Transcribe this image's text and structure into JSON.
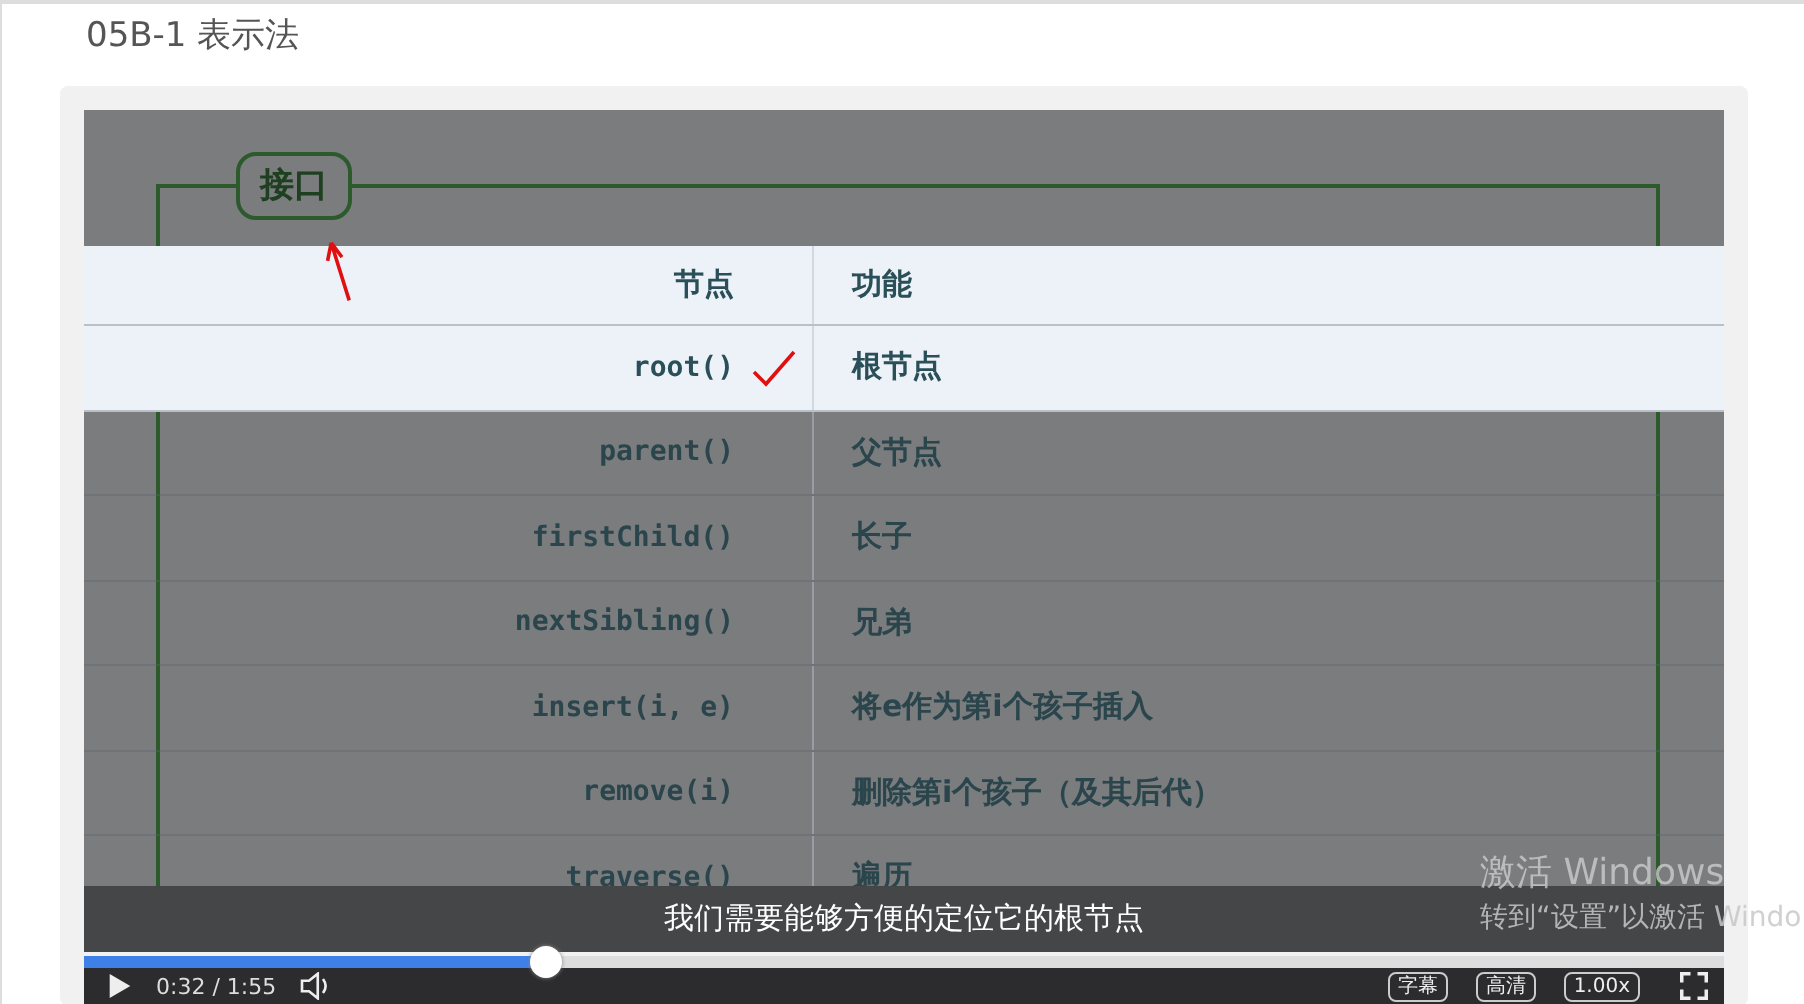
{
  "page_title": "05B-1 表示法",
  "video": {
    "slide": {
      "badge": "接口",
      "header_highlighted": true,
      "columns": [
        "节点",
        "功能"
      ],
      "rows": [
        {
          "cells": [
            "root()",
            "根节点"
          ],
          "highlighted": true,
          "ticked": true
        },
        {
          "cells": [
            "parent()",
            "父节点"
          ],
          "highlighted": false,
          "ticked": false
        },
        {
          "cells": [
            "firstChild()",
            "长子"
          ],
          "highlighted": false,
          "ticked": false
        },
        {
          "cells": [
            "nextSibling()",
            "兄弟"
          ],
          "highlighted": false,
          "ticked": false
        },
        {
          "cells": [
            "insert(i, e)",
            "将e作为第i个孩子插入"
          ],
          "highlighted": false,
          "ticked": false
        },
        {
          "cells": [
            "remove(i)",
            "删除第i个孩子（及其后代）"
          ],
          "highlighted": false,
          "ticked": false
        },
        {
          "cells": [
            "traverse()",
            "遍历"
          ],
          "highlighted": false,
          "ticked": false
        }
      ]
    },
    "subtitle": "我们需要能够方便的定位它的根节点",
    "progress": {
      "level": 0.282
    },
    "time": "0:32 / 1:55",
    "buttons": [
      "字幕",
      "高清",
      "1.00x"
    ]
  },
  "watermark": {
    "title": "激活 Windows",
    "subtitle": "转到“设置”以激活 Windo"
  }
}
